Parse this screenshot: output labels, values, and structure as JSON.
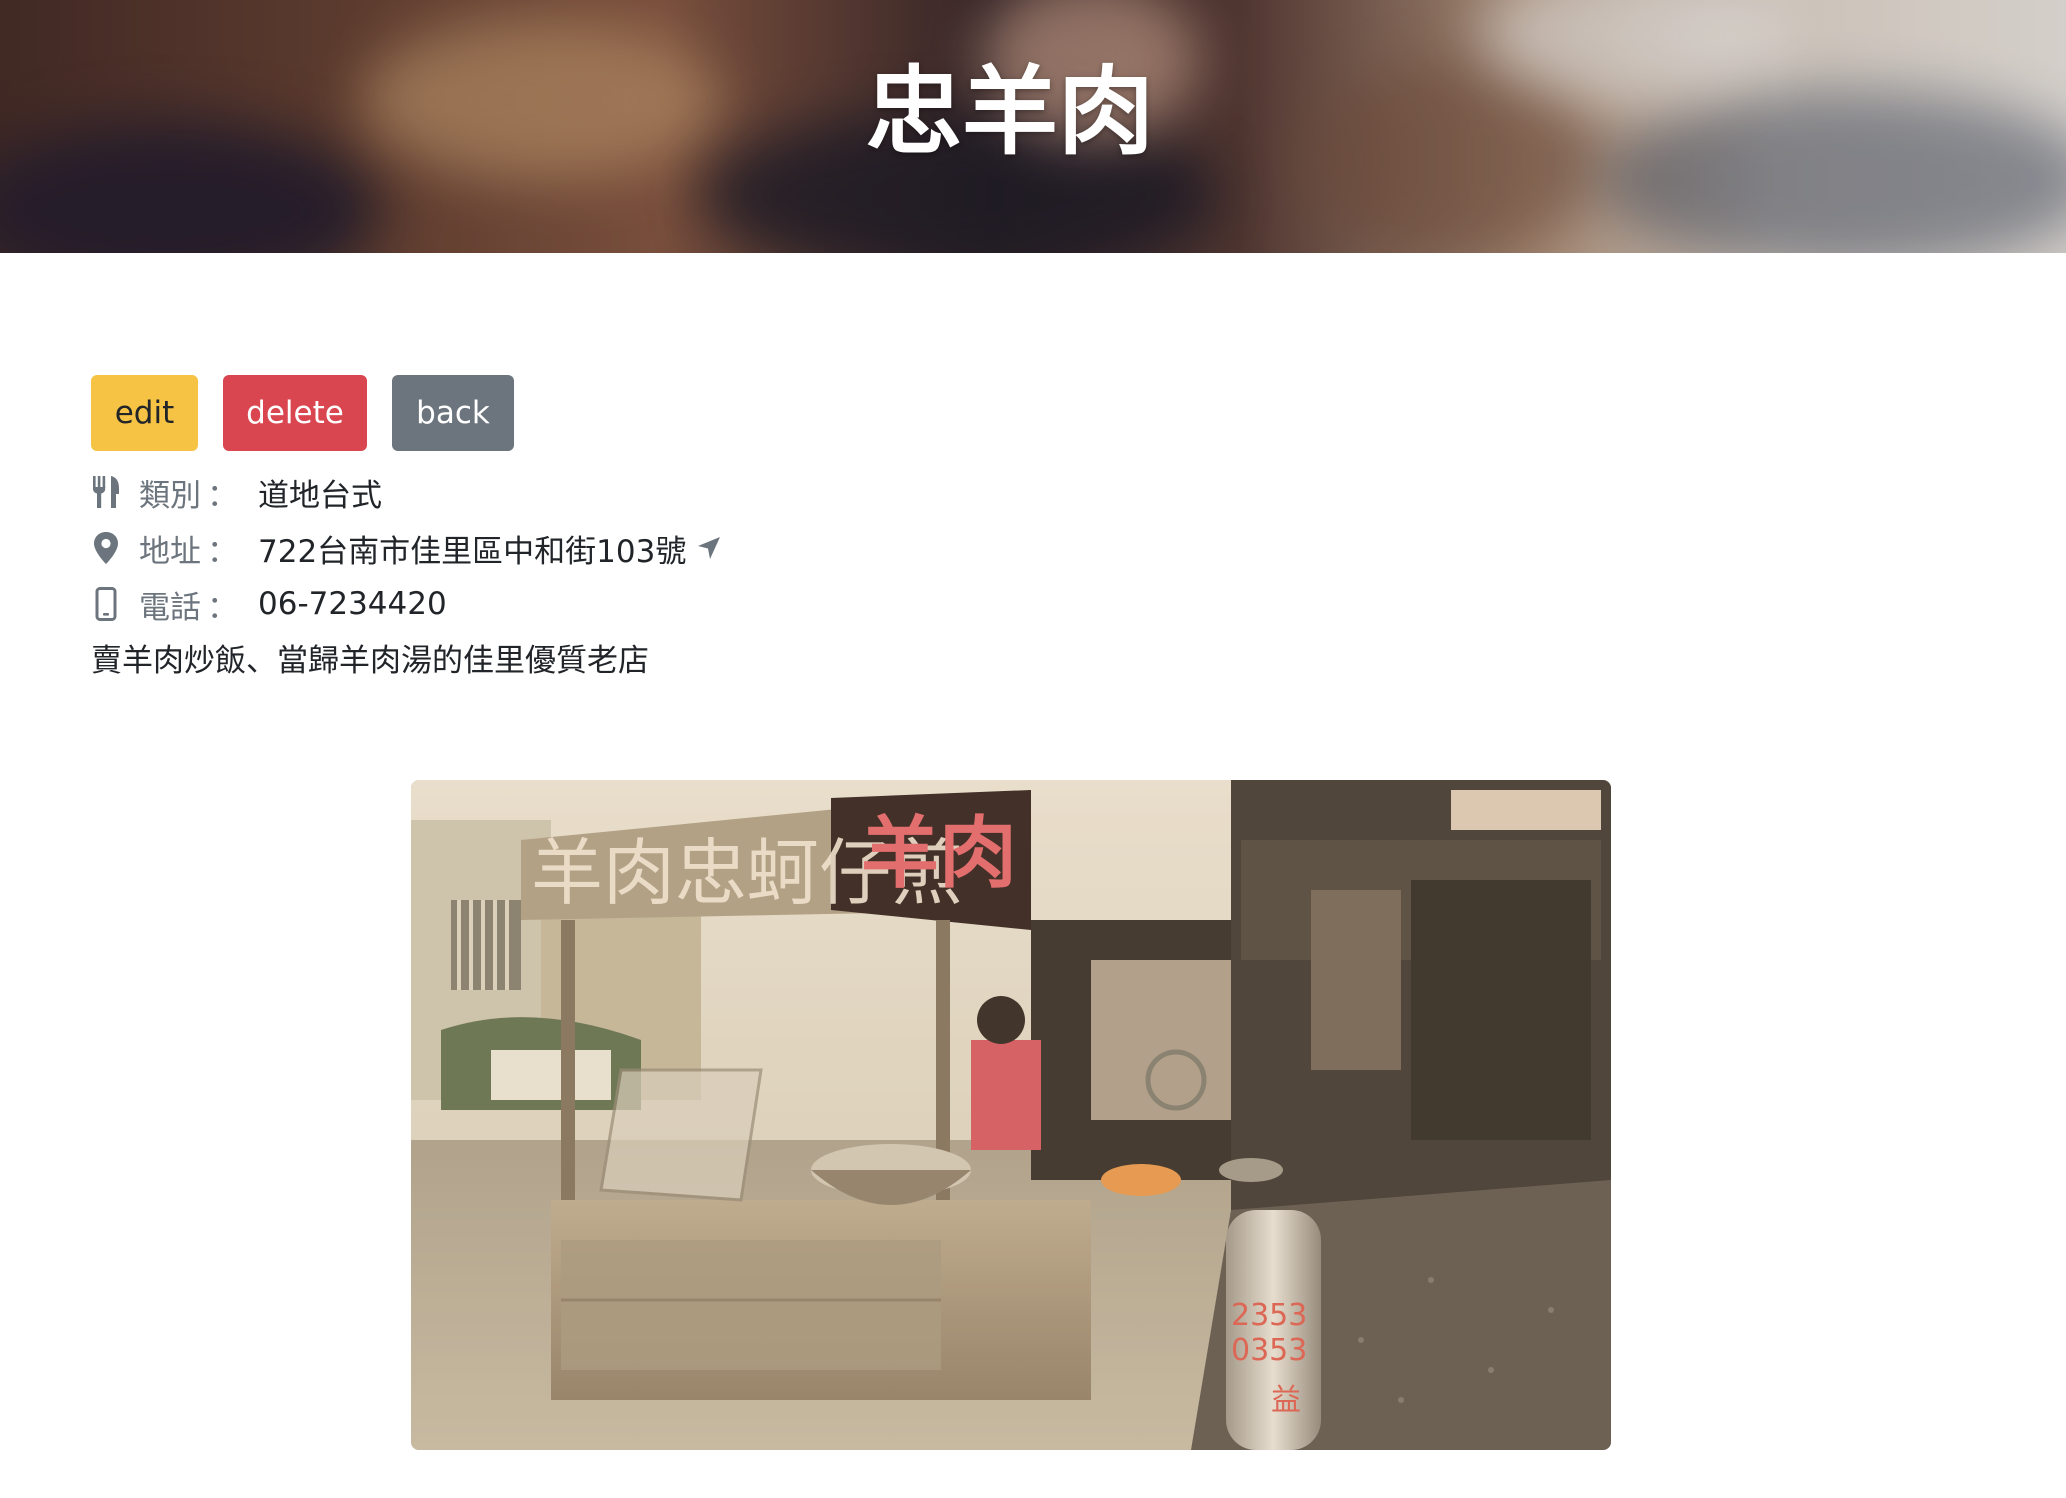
{
  "header": {
    "title": "忠羊肉"
  },
  "actions": {
    "edit_label": "edit",
    "delete_label": "delete",
    "back_label": "back"
  },
  "info": {
    "category": {
      "icon": "utensils-icon",
      "label": "類別",
      "colon": "：",
      "value": "道地台式"
    },
    "address": {
      "icon": "map-marker-icon",
      "label": "地址",
      "colon": "：",
      "value": "722台南市佳里區中和街103號",
      "action_icon": "location-arrow-icon"
    },
    "phone": {
      "icon": "mobile-phone-icon",
      "label": "電話",
      "colon": "：",
      "value": "06-7234420"
    }
  },
  "description": "賣羊肉炒飯、當歸羊肉湯的佳里優質老店",
  "photo": {
    "sign_left": "羊肉忠蚵仔煎",
    "sign_right": "羊肉",
    "tank_text": [
      "2353",
      "0353",
      "益"
    ]
  },
  "colors": {
    "edit": "#f6c344",
    "delete": "#d9464f",
    "back": "#6c757d",
    "label_gray": "#6c757d",
    "text": "#212529"
  }
}
